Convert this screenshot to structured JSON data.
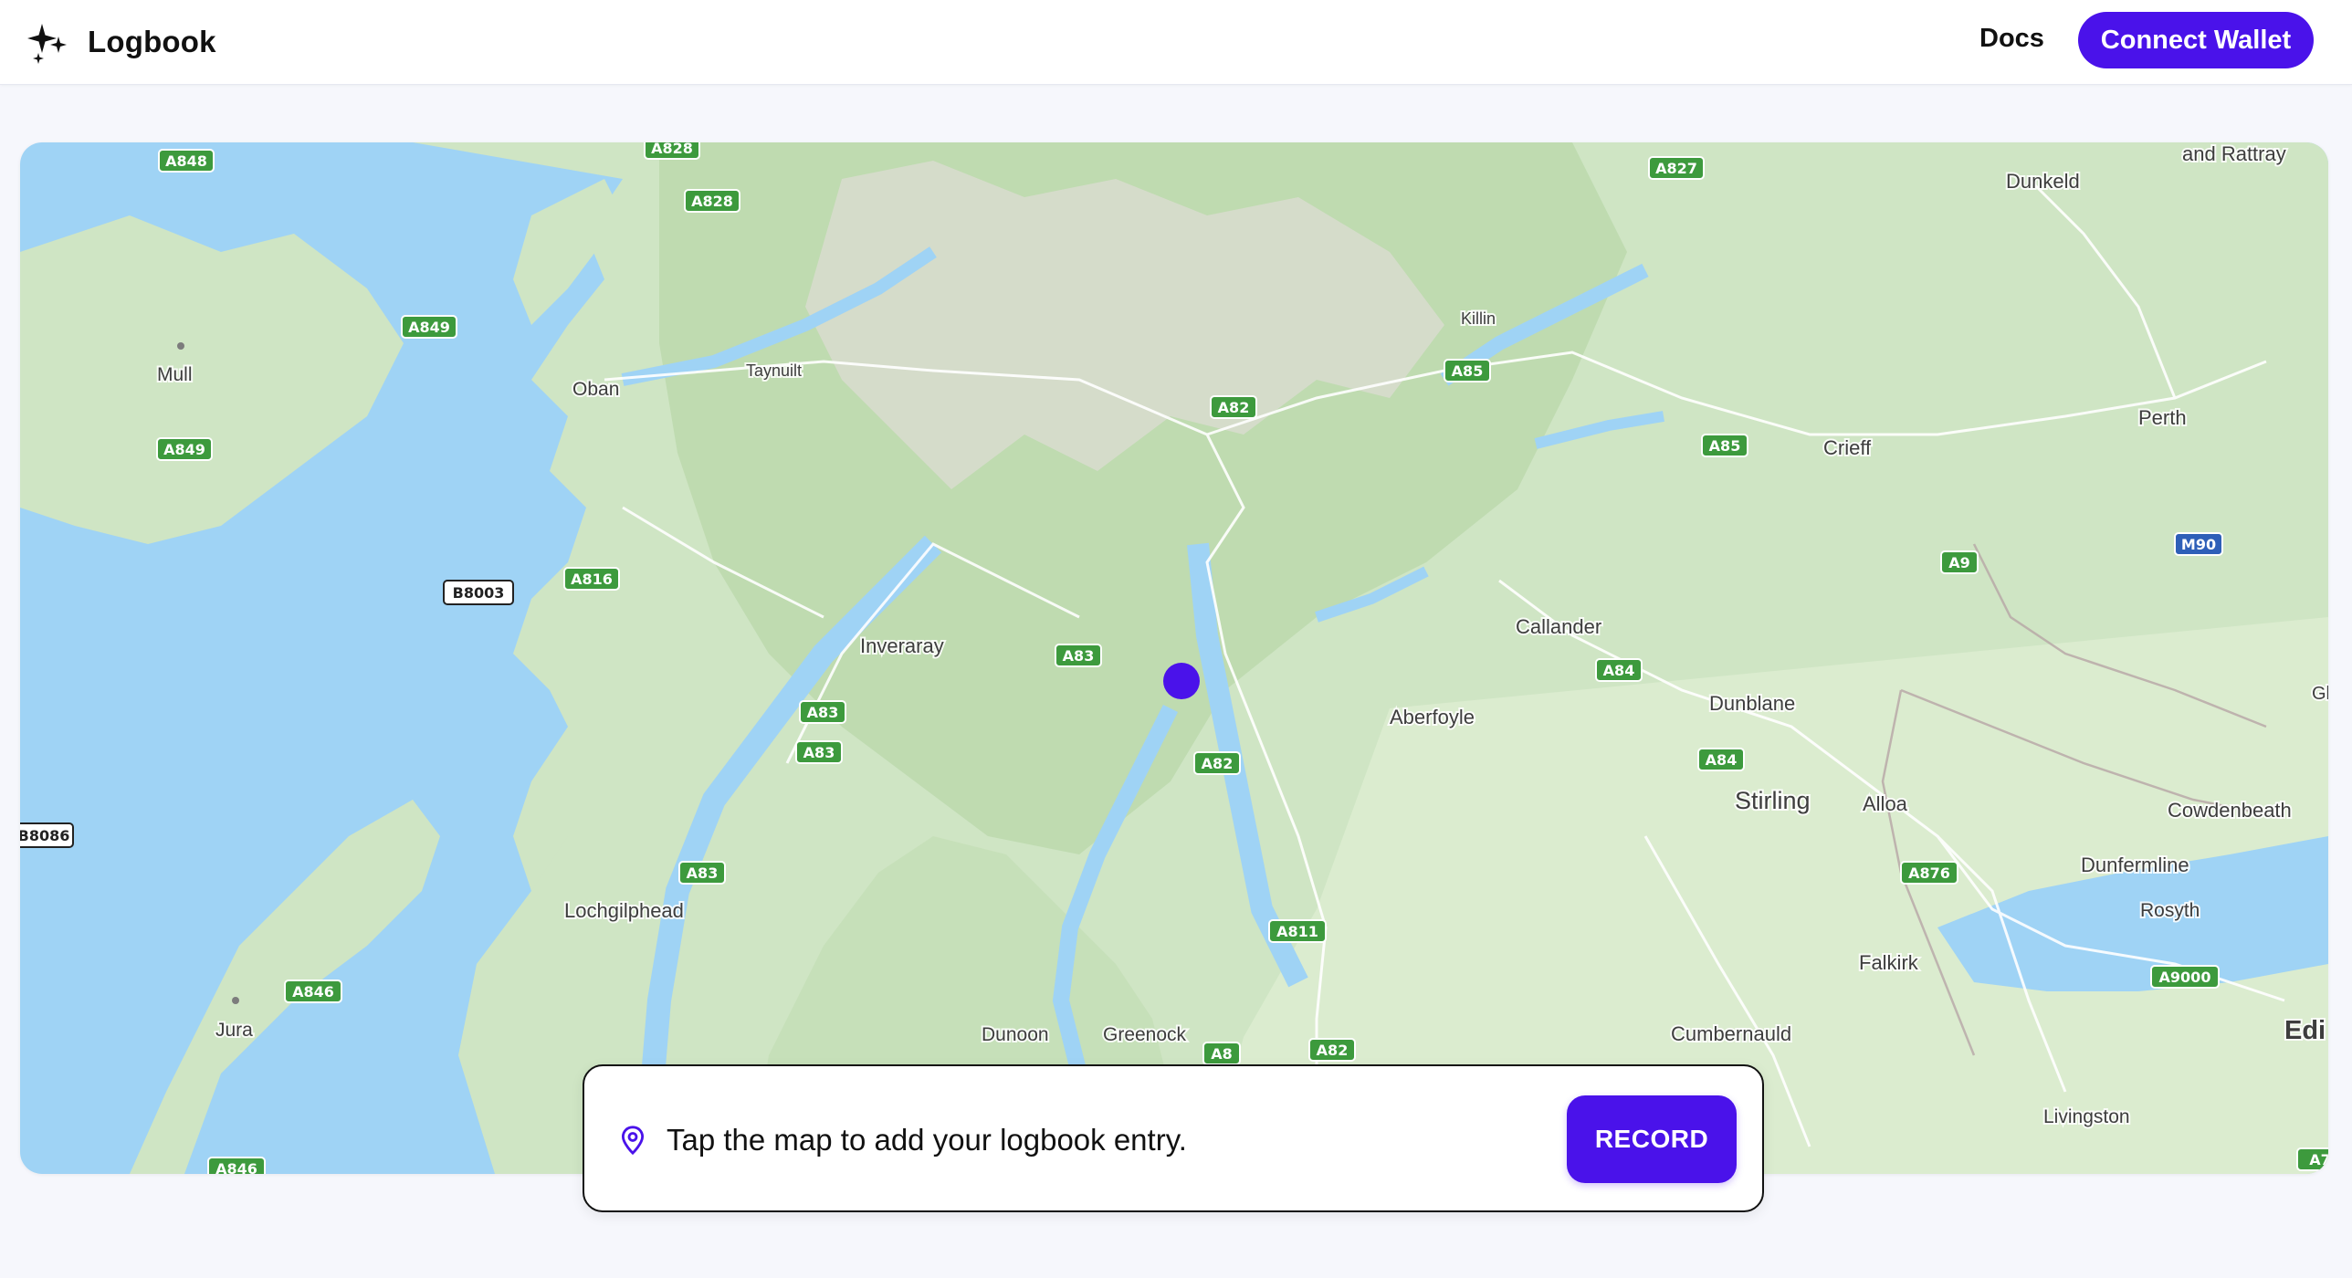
{
  "header": {
    "app_title": "Logbook",
    "logo_icon": "sparkles-icon",
    "docs_label": "Docs",
    "connect_label": "Connect Wallet",
    "accent_color": "#4a12ea"
  },
  "map": {
    "places": [
      {
        "name": "Mull"
      },
      {
        "name": "Oban"
      },
      {
        "name": "Taynuilt"
      },
      {
        "name": "Inveraray"
      },
      {
        "name": "Lochgilphead"
      },
      {
        "name": "Jura"
      },
      {
        "name": "Dunoon"
      },
      {
        "name": "Greenock"
      },
      {
        "name": "Killin"
      },
      {
        "name": "Crieff"
      },
      {
        "name": "Perth"
      },
      {
        "name": "Dunkeld"
      },
      {
        "name": "and Rattray"
      },
      {
        "name": "Callander"
      },
      {
        "name": "Aberfoyle"
      },
      {
        "name": "Dunblane"
      },
      {
        "name": "Stirling"
      },
      {
        "name": "Alloa"
      },
      {
        "name": "Cowdenbeath"
      },
      {
        "name": "Dunfermline"
      },
      {
        "name": "Rosyth"
      },
      {
        "name": "Falkirk"
      },
      {
        "name": "Cumbernauld"
      },
      {
        "name": "Livingston"
      },
      {
        "name": "Edi"
      },
      {
        "name": "Gl"
      }
    ],
    "roads": [
      {
        "ref": "A848"
      },
      {
        "ref": "A828"
      },
      {
        "ref": "A828"
      },
      {
        "ref": "A827"
      },
      {
        "ref": "A849"
      },
      {
        "ref": "A849"
      },
      {
        "ref": "A85"
      },
      {
        "ref": "A82"
      },
      {
        "ref": "A85"
      },
      {
        "ref": "A816"
      },
      {
        "ref": "A9"
      },
      {
        "ref": "M90"
      },
      {
        "ref": "B8003"
      },
      {
        "ref": "A83"
      },
      {
        "ref": "A84"
      },
      {
        "ref": "A83"
      },
      {
        "ref": "A83"
      },
      {
        "ref": "A82"
      },
      {
        "ref": "A84"
      },
      {
        "ref": "B8086"
      },
      {
        "ref": "A83"
      },
      {
        "ref": "A876"
      },
      {
        "ref": "A811"
      },
      {
        "ref": "A846"
      },
      {
        "ref": "A9000"
      },
      {
        "ref": "A8"
      },
      {
        "ref": "A82"
      },
      {
        "ref": "A846"
      },
      {
        "ref": "A7"
      }
    ],
    "marker_color": "#4a12ea"
  },
  "entry": {
    "pin_icon": "map-pin-icon",
    "prompt": "Tap the map to add your logbook entry.",
    "record_label": "RECORD"
  }
}
